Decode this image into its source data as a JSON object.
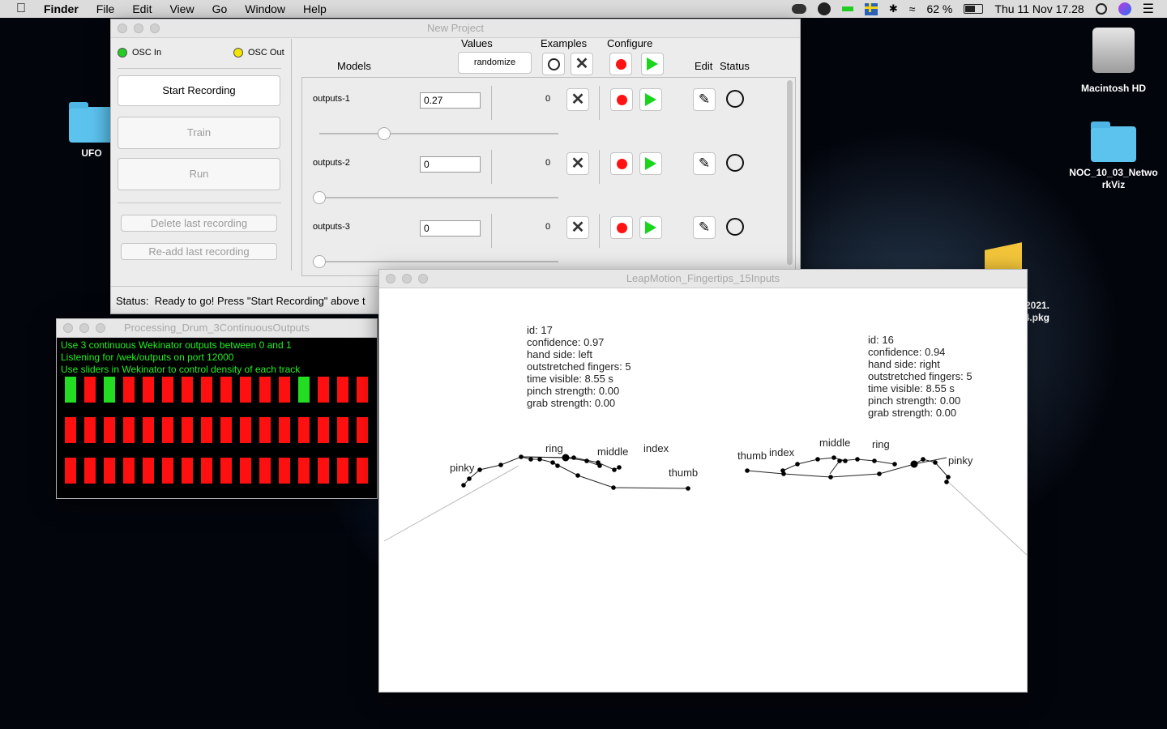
{
  "menubar": {
    "app": "Finder",
    "items": [
      "File",
      "Edit",
      "View",
      "Go",
      "Window",
      "Help"
    ],
    "battery": "62 %",
    "datetime": "Thu 11 Nov  17.28",
    "icons": [
      "apple-icon",
      "creative-cloud-icon",
      "infinity-icon",
      "battery-bar-icon",
      "flag-icon",
      "bluetooth-icon",
      "wifi-icon",
      "battery-icon",
      "search-icon",
      "siri-icon",
      "control-center-icon"
    ]
  },
  "desktop": {
    "icons": [
      {
        "label": "UFO"
      },
      {
        "label": "Macintosh HD"
      },
      {
        "label": "NOC_10_03_NetworkViz"
      },
      {
        "label": "2021.\n4.pkg"
      }
    ]
  },
  "wekinator": {
    "title": "New Project",
    "osc_in": "OSC In",
    "osc_out": "OSC Out",
    "osc_in_color": "#22cc22",
    "osc_out_color": "#f2e600",
    "start_recording": "Start Recording",
    "train": "Train",
    "run": "Run",
    "delete_last": "Delete last recording",
    "readd_last": "Re-add last recording",
    "headers": {
      "values": "Values",
      "examples": "Examples",
      "configure": "Configure",
      "models": "Models",
      "edit": "Edit",
      "status": "Status"
    },
    "randomize": "randomize",
    "outputs": [
      {
        "name": "outputs-1",
        "value": "0.27",
        "examples": "0",
        "slider": 0.27
      },
      {
        "name": "outputs-2",
        "value": "0",
        "examples": "0",
        "slider": 0
      },
      {
        "name": "outputs-3",
        "value": "0",
        "examples": "0",
        "slider": 0
      }
    ],
    "status": "Status:  Ready to go! Press \"Start Recording\" above t"
  },
  "drum": {
    "title": "Processing_Drum_3ContinuousOutputs",
    "lines": [
      "Use 3 continuous Wekinator outputs between 0 and 1",
      "Listening for /wek/outputs on port 12000",
      "Use sliders in Wekinator to control density of each track"
    ],
    "on_color": "#22dd22",
    "off_color": "#ff1010",
    "tracks": [
      [
        1,
        0,
        1,
        0,
        0,
        0,
        0,
        0,
        0,
        0,
        0,
        0,
        1,
        0,
        0,
        0
      ],
      [
        0,
        0,
        0,
        0,
        0,
        0,
        0,
        0,
        0,
        0,
        0,
        0,
        0,
        0,
        0,
        0
      ],
      [
        0,
        0,
        0,
        0,
        0,
        0,
        0,
        0,
        0,
        0,
        0,
        0,
        0,
        0,
        0,
        0
      ]
    ]
  },
  "leap": {
    "title": "LeapMotion_Fingertips_15Inputs",
    "left_hand": "id: 17\nconfidence: 0.97\nhand side: left\noutstretched fingers: 5\ntime visible: 8.55 s\npinch strength: 0.00\ngrab strength: 0.00",
    "right_hand": "id: 16\nconfidence: 0.94\nhand side: right\noutstretched fingers: 5\ntime visible: 8.55 s\npinch strength: 0.00\ngrab strength: 0.00",
    "left_fingers": [
      "pinky",
      "ring",
      "middle",
      "index",
      "thumb"
    ],
    "right_fingers": [
      "thumb",
      "index",
      "middle",
      "ring",
      "pinky"
    ]
  }
}
